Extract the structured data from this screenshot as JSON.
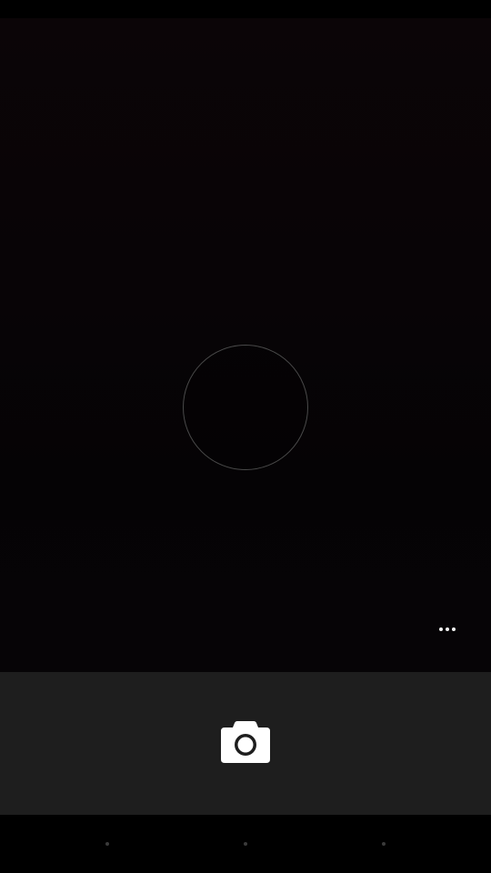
{
  "app": {
    "screen": "camera-viewfinder"
  },
  "viewfinder": {
    "focus_indicator": "focus-ring",
    "overflow_icon": "more-horizontal-icon"
  },
  "controls": {
    "shutter_icon": "camera-icon",
    "bar_color": "#1e1e1e"
  },
  "navigation": {
    "buttons": [
      "back-dot-icon",
      "home-dot-icon",
      "recents-dot-icon"
    ]
  },
  "colors": {
    "background": "#000000",
    "icon": "#ffffff"
  }
}
